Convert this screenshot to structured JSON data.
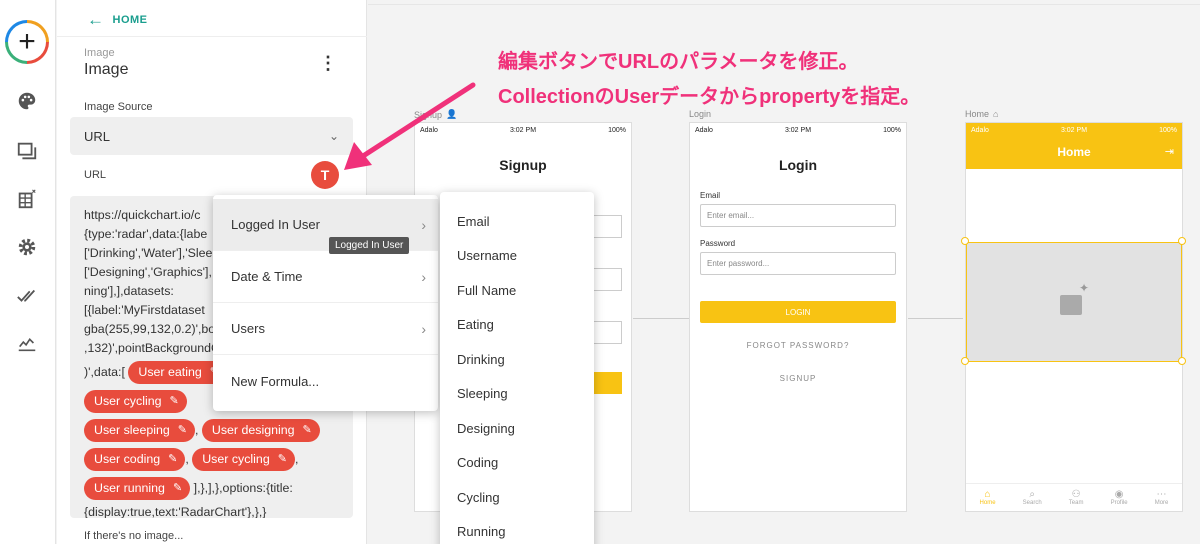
{
  "rail": {
    "icons": [
      "add-icon",
      "palette-icon",
      "screens-icon",
      "database-icon",
      "gear-icon",
      "publish-check-icon",
      "analytics-icon"
    ]
  },
  "panel": {
    "home_label": "HOME",
    "component_type": "Image",
    "component_name": "Image",
    "image_source_label": "Image Source",
    "image_source_value": "URL",
    "url_label": "URL",
    "formula_button_label": "T",
    "url_lines": [
      "https://quickchart.io/c",
      "{type:'radar',data:{labe",
      "['Drinking','Water'],'Slee",
      "['Designing','Graphics'],",
      "ning'],],datasets:",
      "[{label:'MyFirstdataset",
      "gba(255,99,132,0.2)',bor",
      ",132)',pointBackgroundC"
    ],
    "data_prefix": ")',data:[",
    "chips": [
      "User eating",
      "User cycling",
      "User sleeping",
      "User designing",
      "User coding",
      "User cycling",
      "User running"
    ],
    "url_tail_1": "],},],},options:{title:",
    "url_tail_2": "{display:true,text:'RadarChart'},},}",
    "no_image_label": "If there's no image..."
  },
  "menu1": {
    "items": [
      "Logged In User",
      "Date & Time",
      "Users",
      "New Formula..."
    ],
    "tooltip": "Logged In User"
  },
  "menu2": {
    "items": [
      "Email",
      "Username",
      "Full Name",
      "Eating",
      "Drinking",
      "Sleeping",
      "Designing",
      "Coding",
      "Cycling",
      "Running"
    ]
  },
  "annotation": {
    "line1": "編集ボタンでURLのパラメータを修正。",
    "line2": "CollectionのUserデータからpropertyを指定。"
  },
  "screens": {
    "signup": {
      "label": "Signup",
      "title": "Signup",
      "carrier": "Adalo",
      "time": "3:02 PM",
      "battery": "100%"
    },
    "login": {
      "label": "Login",
      "title": "Login",
      "carrier": "Adalo",
      "time": "3:02 PM",
      "battery": "100%",
      "email_label": "Email",
      "email_placeholder": "Enter email...",
      "password_label": "Password",
      "password_placeholder": "Enter password...",
      "login_button": "LOGIN",
      "forgot": "FORGOT PASSWORD?",
      "signup_link": "SIGNUP"
    },
    "home": {
      "label": "Home",
      "title": "Home",
      "carrier": "Adalo",
      "time": "3:02 PM",
      "battery": "100%",
      "tabs": [
        "Home",
        "Search",
        "Team",
        "Profile",
        "More"
      ]
    }
  },
  "colors": {
    "accent": "#e84c3d",
    "teal": "#1a9e8e",
    "yellow": "#f8c313",
    "annotation": "#f0317a"
  }
}
